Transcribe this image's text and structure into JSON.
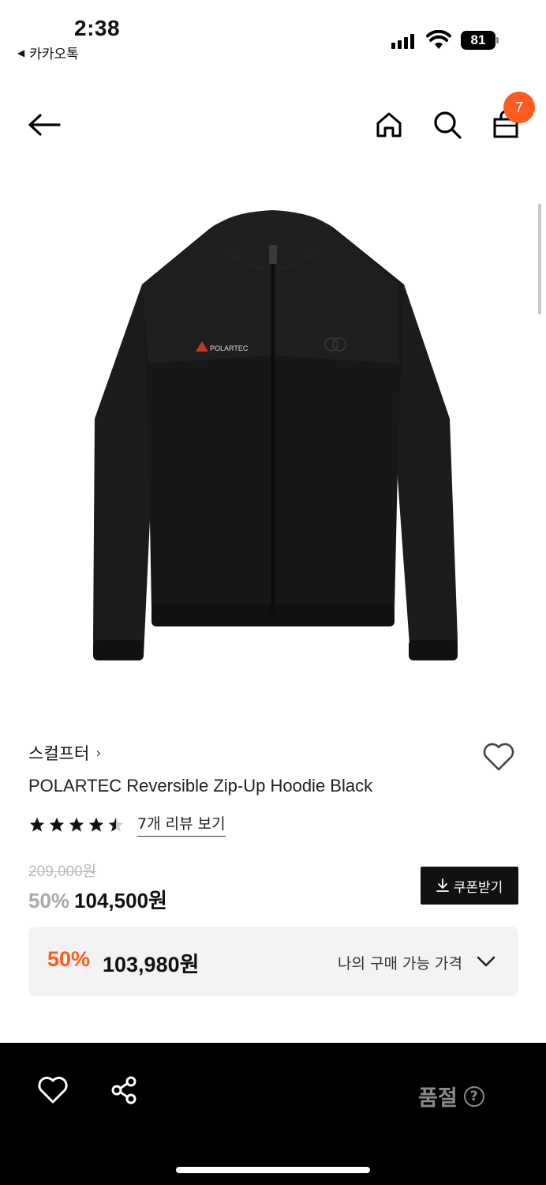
{
  "status_bar": {
    "time": "2:38",
    "back_app": "카카오톡",
    "battery": "81"
  },
  "nav": {
    "cart_count": "7"
  },
  "product": {
    "brand": "스컬프터",
    "title": "POLARTEC Reversible Zip-Up Hoodie Black",
    "rating": 4.5,
    "review_link": "7개 리뷰 보기",
    "original_price": "209,000원",
    "sale_percent": "50%",
    "sale_price": "104,500원",
    "coupon_label": "쿠폰받기",
    "my_price_percent": "50%",
    "my_price": "103,980원",
    "my_price_label": "나의 구매 가능 가격",
    "image_logo_text": "POLARTEC"
  },
  "bottom_bar": {
    "status_label": "품절",
    "help_glyph": "?"
  },
  "colors": {
    "accent": "#ff5a1f",
    "dark": "#111111",
    "muted": "#8a8a8a",
    "panel": "#f3f3f3"
  },
  "icons": [
    "back-arrow-icon",
    "home-icon",
    "search-icon",
    "bag-icon",
    "heart-icon",
    "share-icon",
    "download-icon",
    "chevron-down-icon",
    "help-icon"
  ]
}
